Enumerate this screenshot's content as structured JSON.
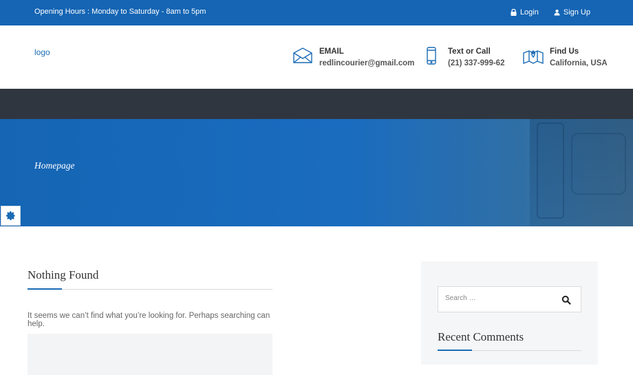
{
  "topbar": {
    "hours": "Opening Hours : Monday to Saturday - 8am to 5pm",
    "login": "Login",
    "signup": "Sign Up"
  },
  "header": {
    "logo": "logo",
    "email": {
      "title": "EMAIL",
      "value": "redlincourier@gmail.com",
      "icon": "envelope-icon"
    },
    "call": {
      "title": "Text or Call",
      "value": "(21) 337-999-62",
      "icon": "mobile-phone-icon"
    },
    "find": {
      "title": "Find Us",
      "value": "California, USA",
      "icon": "map-icon"
    }
  },
  "hero": {
    "breadcrumb": "Homepage"
  },
  "main": {
    "title": "Nothing Found",
    "message": "It seems we can’t find what you’re looking for. Perhaps searching can help."
  },
  "sidebar": {
    "search_placeholder": "Search …",
    "recent_comments_title": "Recent Comments"
  },
  "colors": {
    "primary": "#1565b4",
    "navbar": "#2f3640",
    "accent": "#1b6bb5"
  }
}
